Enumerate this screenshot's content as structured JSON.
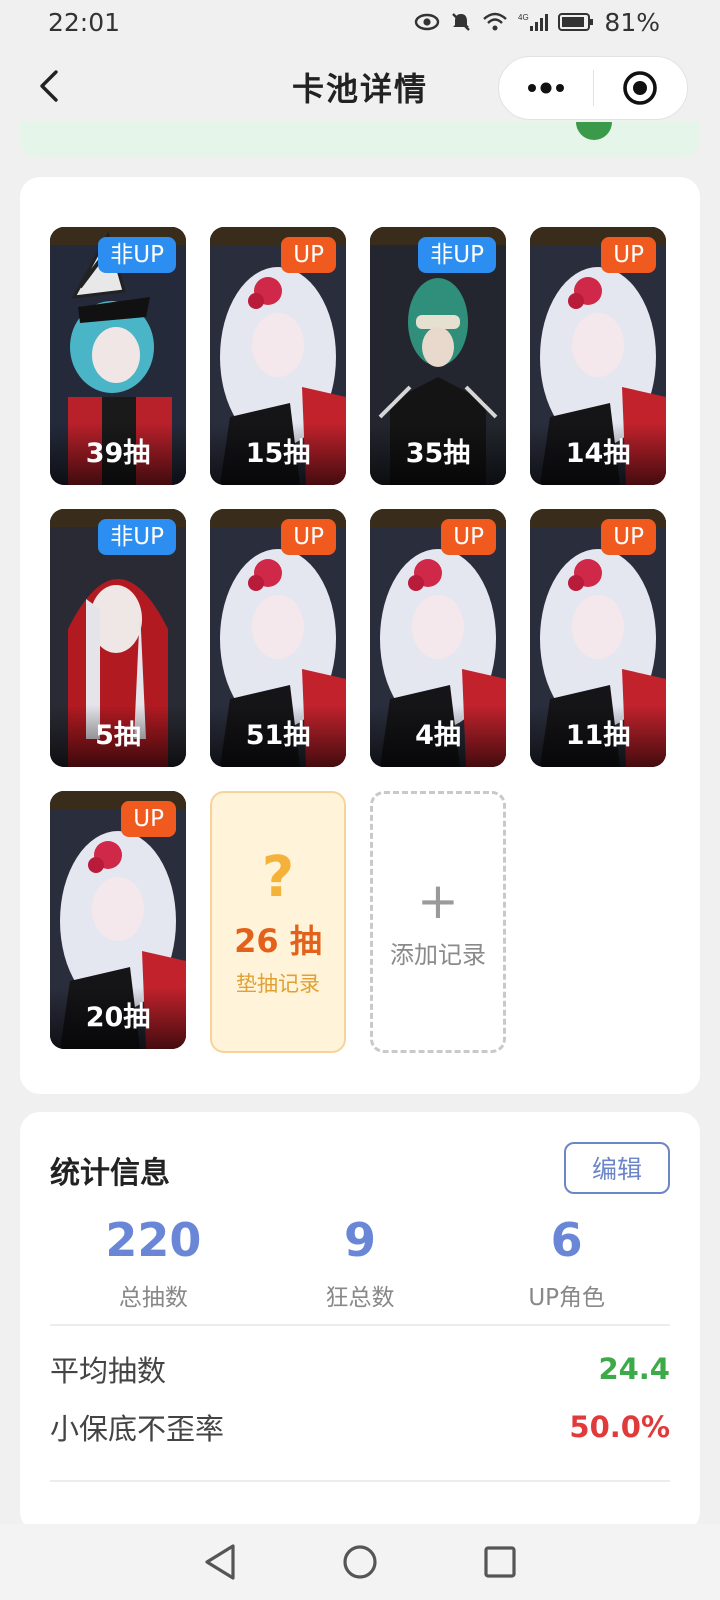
{
  "status_bar": {
    "time": "22:01",
    "battery": "81%",
    "network": "4G"
  },
  "header": {
    "title": "卡池详情"
  },
  "cards": [
    {
      "tag": "非UP",
      "tag_type": "nonup",
      "count": "39抽",
      "art": "stitched-hat-girl"
    },
    {
      "tag": "UP",
      "tag_type": "up",
      "count": "15抽",
      "art": "white-hair-red-flower"
    },
    {
      "tag": "非UP",
      "tag_type": "nonup",
      "count": "35抽",
      "art": "green-hair-mask"
    },
    {
      "tag": "UP",
      "tag_type": "up",
      "count": "14抽",
      "art": "white-hair-red-flower"
    },
    {
      "tag": "非UP",
      "tag_type": "nonup",
      "count": "5抽",
      "art": "red-hood"
    },
    {
      "tag": "UP",
      "tag_type": "up",
      "count": "51抽",
      "art": "white-hair-red-flower"
    },
    {
      "tag": "UP",
      "tag_type": "up",
      "count": "4抽",
      "art": "white-hair-red-flower"
    },
    {
      "tag": "UP",
      "tag_type": "up",
      "count": "11抽",
      "art": "white-hair-red-flower"
    },
    {
      "tag": "UP",
      "tag_type": "up",
      "count": "20抽",
      "art": "white-hair-red-flower"
    }
  ],
  "pity_card": {
    "symbol": "?",
    "pulls": "26 抽",
    "label": "垫抽记录"
  },
  "add_card": {
    "symbol": "+",
    "label": "添加记录"
  },
  "stats": {
    "title": "统计信息",
    "edit_label": "编辑",
    "items": [
      {
        "value": "220",
        "label": "总抽数"
      },
      {
        "value": "9",
        "label": "狂总数"
      },
      {
        "value": "6",
        "label": "UP角色"
      }
    ],
    "avg_label": "平均抽数",
    "avg_value": "24.4",
    "rate_label": "小保底不歪率",
    "rate_value": "50.0%",
    "colors": {
      "accent": "#6a86d6",
      "green": "#3daa4a",
      "red": "#e03a3a",
      "up_tag": "#f05a1e",
      "nonup_tag": "#2b8ef0"
    }
  }
}
